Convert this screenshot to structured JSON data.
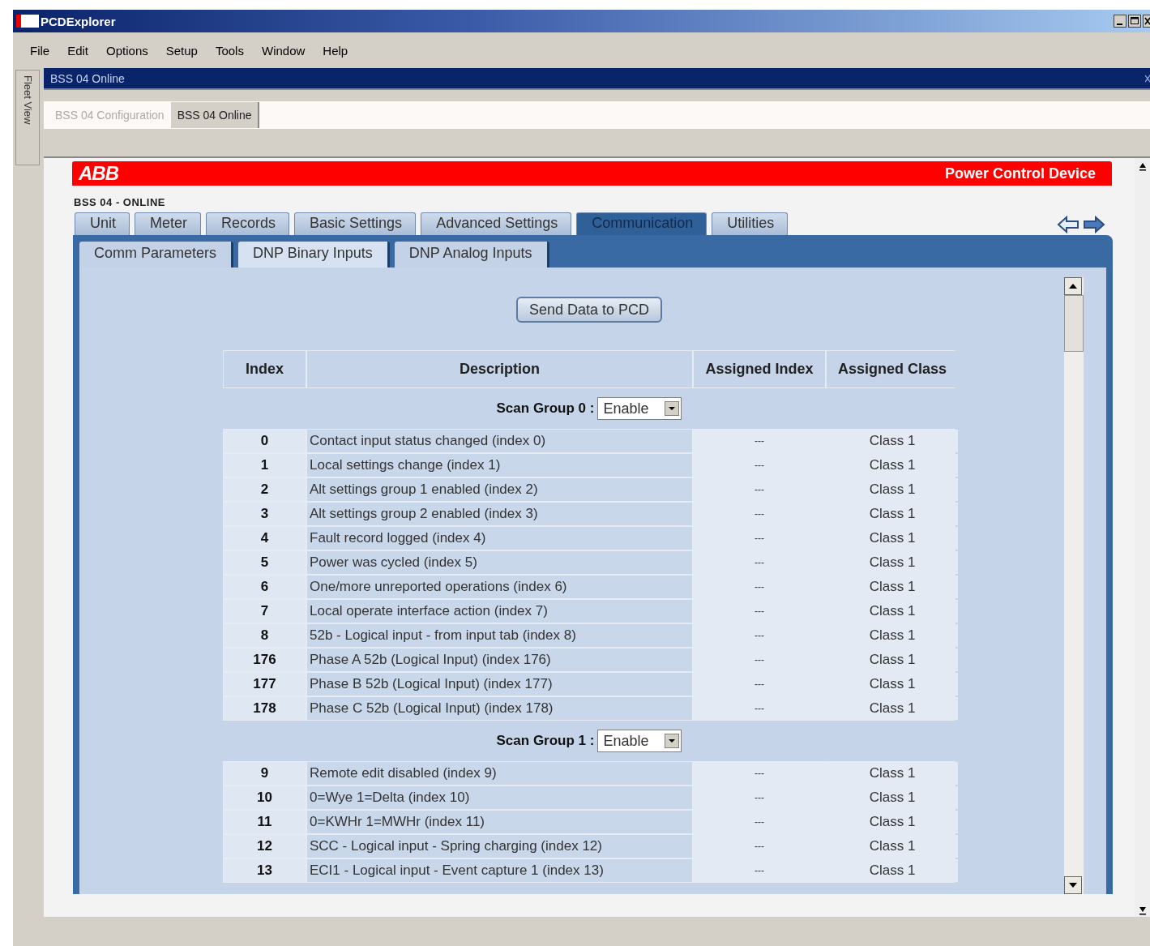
{
  "window": {
    "title": "PCDExplorer"
  },
  "menu": [
    "File",
    "Edit",
    "Options",
    "Setup",
    "Tools",
    "Window",
    "Help"
  ],
  "side_panel": {
    "label": "Fleet View"
  },
  "child_window": {
    "title": "BSS 04 Online"
  },
  "document_tabs": [
    {
      "label": "BSS 04 Configuration",
      "selected": false
    },
    {
      "label": "BSS 04 Online",
      "selected": true
    }
  ],
  "banner": {
    "logo": "ABB",
    "title": "Power Control Device"
  },
  "device_label": "BSS 04 - ONLINE",
  "tabs": [
    {
      "label": "Unit",
      "selected": false
    },
    {
      "label": "Meter",
      "selected": false
    },
    {
      "label": "Records",
      "selected": false
    },
    {
      "label": "Basic Settings",
      "selected": false
    },
    {
      "label": "Advanced Settings",
      "selected": false
    },
    {
      "label": "Communication",
      "selected": true
    },
    {
      "label": "Utilities",
      "selected": false
    }
  ],
  "subtabs": [
    {
      "label": "Comm Parameters",
      "selected": false
    },
    {
      "label": "DNP Binary Inputs",
      "selected": true
    },
    {
      "label": "DNP Analog Inputs",
      "selected": false
    }
  ],
  "send_button": "Send Data to PCD",
  "table": {
    "columns": [
      "Index",
      "Description",
      "Assigned Index",
      "Assigned Class"
    ],
    "groups": [
      {
        "label": "Scan Group 0 :",
        "value": "Enable",
        "rows": [
          {
            "index": "0",
            "description": "Contact input status changed (index 0)",
            "assigned_index": "---",
            "assigned_class": "Class 1"
          },
          {
            "index": "1",
            "description": "Local settings change (index 1)",
            "assigned_index": "---",
            "assigned_class": "Class 1"
          },
          {
            "index": "2",
            "description": "Alt settings group 1 enabled (index 2)",
            "assigned_index": "---",
            "assigned_class": "Class 1"
          },
          {
            "index": "3",
            "description": "Alt settings group 2 enabled (index 3)",
            "assigned_index": "---",
            "assigned_class": "Class 1"
          },
          {
            "index": "4",
            "description": "Fault record logged (index 4)",
            "assigned_index": "---",
            "assigned_class": "Class 1"
          },
          {
            "index": "5",
            "description": "Power was cycled (index 5)",
            "assigned_index": "---",
            "assigned_class": "Class 1"
          },
          {
            "index": "6",
            "description": "One/more unreported operations (index 6)",
            "assigned_index": "---",
            "assigned_class": "Class 1"
          },
          {
            "index": "7",
            "description": "Local operate interface action (index 7)",
            "assigned_index": "---",
            "assigned_class": "Class 1"
          },
          {
            "index": "8",
            "description": "52b - Logical input - from input tab (index 8)",
            "assigned_index": "---",
            "assigned_class": "Class 1"
          },
          {
            "index": "176",
            "description": "Phase A 52b (Logical Input) (index 176)",
            "assigned_index": "---",
            "assigned_class": "Class 1"
          },
          {
            "index": "177",
            "description": "Phase B 52b (Logical Input) (index 177)",
            "assigned_index": "---",
            "assigned_class": "Class 1"
          },
          {
            "index": "178",
            "description": "Phase C 52b (Logical Input) (index 178)",
            "assigned_index": "---",
            "assigned_class": "Class 1"
          }
        ]
      },
      {
        "label": "Scan Group 1 :",
        "value": "Enable",
        "rows": [
          {
            "index": "9",
            "description": "Remote edit disabled (index 9)",
            "assigned_index": "---",
            "assigned_class": "Class 1"
          },
          {
            "index": "10",
            "description": "0=Wye 1=Delta (index 10)",
            "assigned_index": "---",
            "assigned_class": "Class 1"
          },
          {
            "index": "11",
            "description": "0=KWHr 1=MWHr (index 11)",
            "assigned_index": "---",
            "assigned_class": "Class 1"
          },
          {
            "index": "12",
            "description": "SCC - Logical input - Spring charging (index 12)",
            "assigned_index": "---",
            "assigned_class": "Class 1"
          },
          {
            "index": "13",
            "description": "ECI1 - Logical input - Event capture 1 (index 13)",
            "assigned_index": "---",
            "assigned_class": "Class 1"
          }
        ]
      }
    ]
  }
}
